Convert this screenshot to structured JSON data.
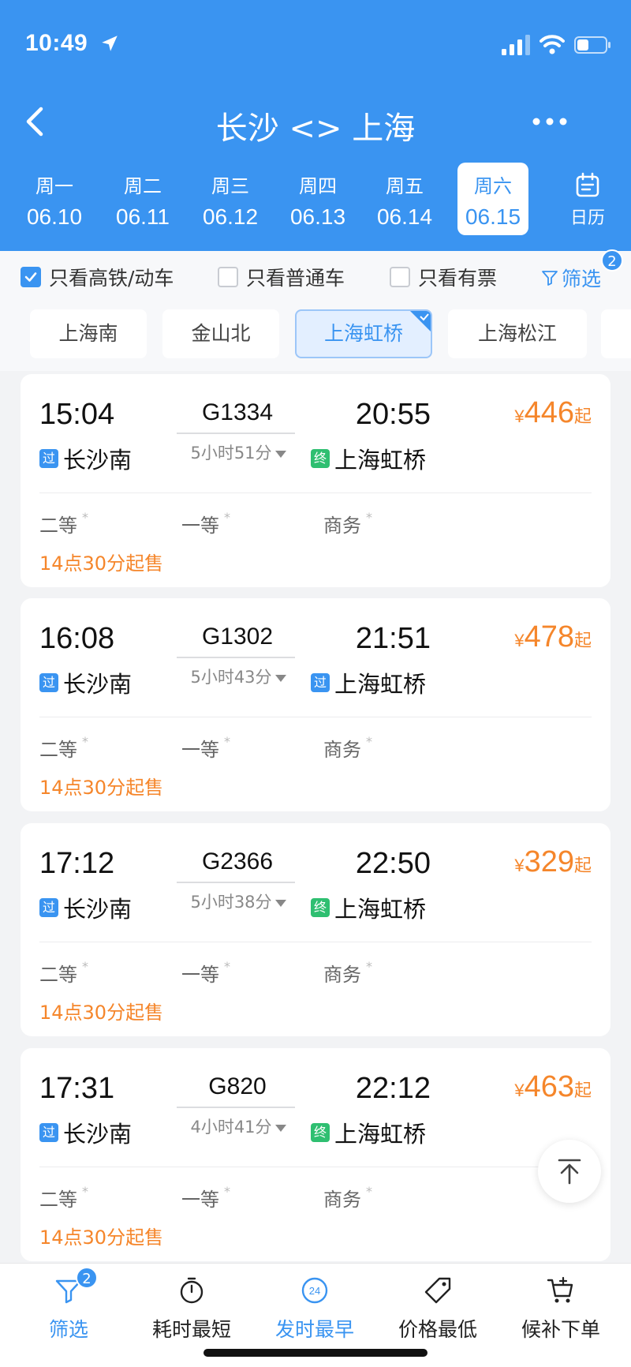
{
  "status_bar": {
    "time": "10:49"
  },
  "nav": {
    "title": "长沙 <> 上海"
  },
  "dates": [
    {
      "weekday": "周一",
      "date": "06.10",
      "active": false
    },
    {
      "weekday": "周二",
      "date": "06.11",
      "active": false
    },
    {
      "weekday": "周三",
      "date": "06.12",
      "active": false
    },
    {
      "weekday": "周四",
      "date": "06.13",
      "active": false
    },
    {
      "weekday": "周五",
      "date": "06.14",
      "active": false
    },
    {
      "weekday": "周六",
      "date": "06.15",
      "active": true
    }
  ],
  "calendar_label": "日历",
  "filters": {
    "high_speed_only": {
      "label": "只看高铁/动车",
      "checked": true
    },
    "regular_only": {
      "label": "只看普通车",
      "checked": false
    },
    "available_only": {
      "label": "只看有票",
      "checked": false
    },
    "filter_label": "筛选",
    "filter_count": "2"
  },
  "stations": [
    {
      "name": "上海南",
      "selected": false
    },
    {
      "name": "金山北",
      "selected": false
    },
    {
      "name": "上海虹桥",
      "selected": true
    },
    {
      "name": "上海松江",
      "selected": false
    }
  ],
  "trains": [
    {
      "dep_time": "15:04",
      "train_no": "G1334",
      "arr_time": "20:55",
      "duration": "5小时51分",
      "dep_station": "长沙南",
      "dep_tag": "过",
      "arr_station": "上海虹桥",
      "arr_tag": "终",
      "price_symbol": "¥",
      "price": "446",
      "price_suffix": "起",
      "seat_2nd": "二等",
      "seat_1st": "一等",
      "seat_biz": "商务",
      "seat_mark": "*",
      "sale_time": "14点30分起售"
    },
    {
      "dep_time": "16:08",
      "train_no": "G1302",
      "arr_time": "21:51",
      "duration": "5小时43分",
      "dep_station": "长沙南",
      "dep_tag": "过",
      "arr_station": "上海虹桥",
      "arr_tag": "过",
      "price_symbol": "¥",
      "price": "478",
      "price_suffix": "起",
      "seat_2nd": "二等",
      "seat_1st": "一等",
      "seat_biz": "商务",
      "seat_mark": "*",
      "sale_time": "14点30分起售"
    },
    {
      "dep_time": "17:12",
      "train_no": "G2366",
      "arr_time": "22:50",
      "duration": "5小时38分",
      "dep_station": "长沙南",
      "dep_tag": "过",
      "arr_station": "上海虹桥",
      "arr_tag": "终",
      "price_symbol": "¥",
      "price": "329",
      "price_suffix": "起",
      "seat_2nd": "二等",
      "seat_1st": "一等",
      "seat_biz": "商务",
      "seat_mark": "*",
      "sale_time": "14点30分起售"
    },
    {
      "dep_time": "17:31",
      "train_no": "G820",
      "arr_time": "22:12",
      "duration": "4小时41分",
      "dep_station": "长沙南",
      "dep_tag": "过",
      "arr_station": "上海虹桥",
      "arr_tag": "终",
      "price_symbol": "¥",
      "price": "463",
      "price_suffix": "起",
      "seat_2nd": "二等",
      "seat_1st": "一等",
      "seat_biz": "商务",
      "seat_mark": "*",
      "sale_time": "14点30分起售"
    }
  ],
  "bottom_tabs": [
    {
      "label": "筛选",
      "icon": "filter-icon",
      "badge": "2",
      "active": true
    },
    {
      "label": "耗时最短",
      "icon": "stopwatch-icon",
      "active": false
    },
    {
      "label": "发时最早",
      "icon": "clock-24-icon",
      "icon_text": "24",
      "active": true
    },
    {
      "label": "价格最低",
      "icon": "price-tag-icon",
      "active": false
    },
    {
      "label": "候补下单",
      "icon": "cart-plus-icon",
      "active": false
    }
  ],
  "colors": {
    "brand_blue": "#3a94f1",
    "price_orange": "#f5862b",
    "end_tag_green": "#2fbf71"
  }
}
